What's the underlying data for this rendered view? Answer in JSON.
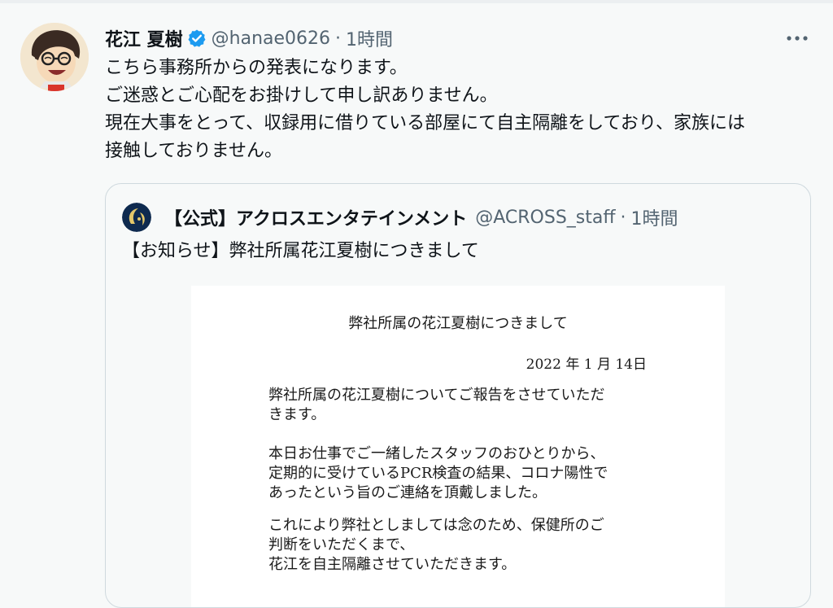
{
  "tweet": {
    "author_name": "花江 夏樹",
    "handle": "@hanae0626",
    "separator": "·",
    "time": "1時間",
    "verified_icon": "verified-badge-icon",
    "more_icon": "more-options-icon",
    "body_lines": [
      "こちら事務所からの発表になります。",
      "ご迷惑とご心配をお掛けして申し訳ありません。",
      "現在大事をとって、収録用に借りている部屋にて自主隔離をしており、家族には",
      "接触しておりません。"
    ]
  },
  "quote": {
    "author_name": "【公式】アクロスエンタテインメント",
    "handle": "@ACROSS_staff",
    "separator": "·",
    "time": "1時間",
    "text": "【お知らせ】弊社所属花江夏樹につきまして",
    "notice": {
      "title": "弊社所属の花江夏樹につきまして",
      "date": "2022 年 1 月 14日",
      "paragraphs": [
        [
          "弊社所属の花江夏樹についてご報告をさせていただ",
          "きます。"
        ],
        [
          "本日お仕事でご一緒したスタッフのおひとりから、",
          "定期的に受けているPCR検査の結果、コロナ陽性で",
          "あったという旨のご連絡を頂戴しました。"
        ],
        [
          "これにより弊社としましては念のため、保健所のご",
          "判断をいただくまで、",
          "花江を自主隔離させていただきます。"
        ]
      ]
    }
  },
  "colors": {
    "background": "#f7f9f9",
    "text": "#0f1419",
    "secondary_text": "#536471",
    "verified_blue": "#1d9bf0",
    "card_border": "#cfd9de"
  }
}
